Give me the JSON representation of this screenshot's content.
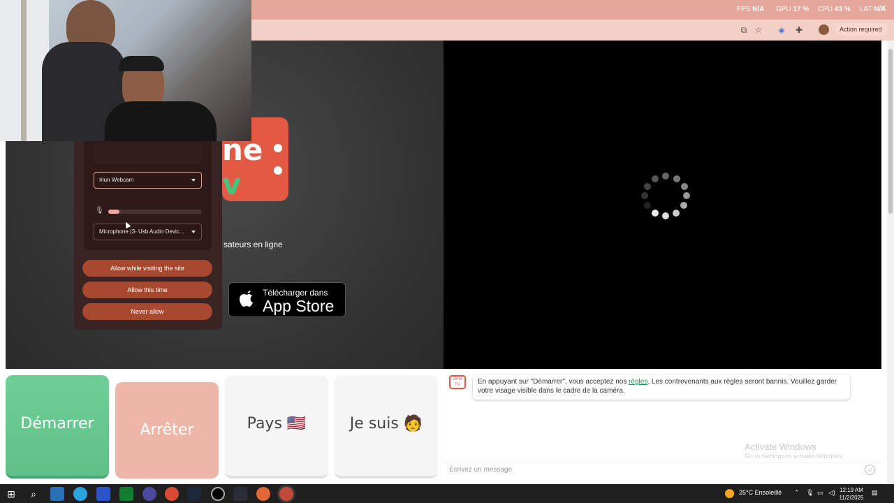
{
  "overlay": {
    "fps_label": "FPS",
    "fps_value": "N/A",
    "gpu_label": "GPU",
    "gpu_value": "17 %",
    "cpu_label": "CPU",
    "cpu_value": "43 %",
    "lat_label": "LAT",
    "lat_value": "N/A"
  },
  "browser": {
    "action_required": "Action required"
  },
  "video": {
    "logo_text": "ne",
    "logo_text2": "v",
    "users_online": "sateurs en ligne",
    "appstore_small": "Télécharger dans",
    "appstore_big": "App Store"
  },
  "permission": {
    "camera_select": "Iriun Webcam",
    "mic_select": "Microphone (3- Usb Audio Devic...",
    "mic_level": 0.12,
    "allow_visiting": "Allow while visiting the site",
    "allow_once": "Allow this time",
    "never_allow": "Never allow"
  },
  "actions": {
    "start": "Démarrer",
    "stop": "Arrêter",
    "country": "Pays",
    "country_flag": "🇺🇸",
    "iam": "Je suis",
    "iam_emoji": "🧑"
  },
  "chat": {
    "notice_before": "En appuyant sur \"Démarrer\", vous acceptez nos ",
    "notice_link": "règles",
    "notice_after": ". Les contrevenants aux règles seront bannis. Veuillez garder votre visage visible dans le cadre de la caméra.",
    "tv_icon_label": "Ome TV",
    "placeholder": "Écrivez un message"
  },
  "watermark": {
    "title": "Activate Windows",
    "subtitle": "Go to Settings to activate Windows."
  },
  "taskbar": {
    "weather": "25°C  Ensoleillé",
    "time": "12:19 AM",
    "date": "11/2/2025"
  },
  "colors": {
    "accent": "#e35a44",
    "start_green": "#6fcf97",
    "stop_pink": "#eeb6a9",
    "perm_button": "#a8492f"
  }
}
